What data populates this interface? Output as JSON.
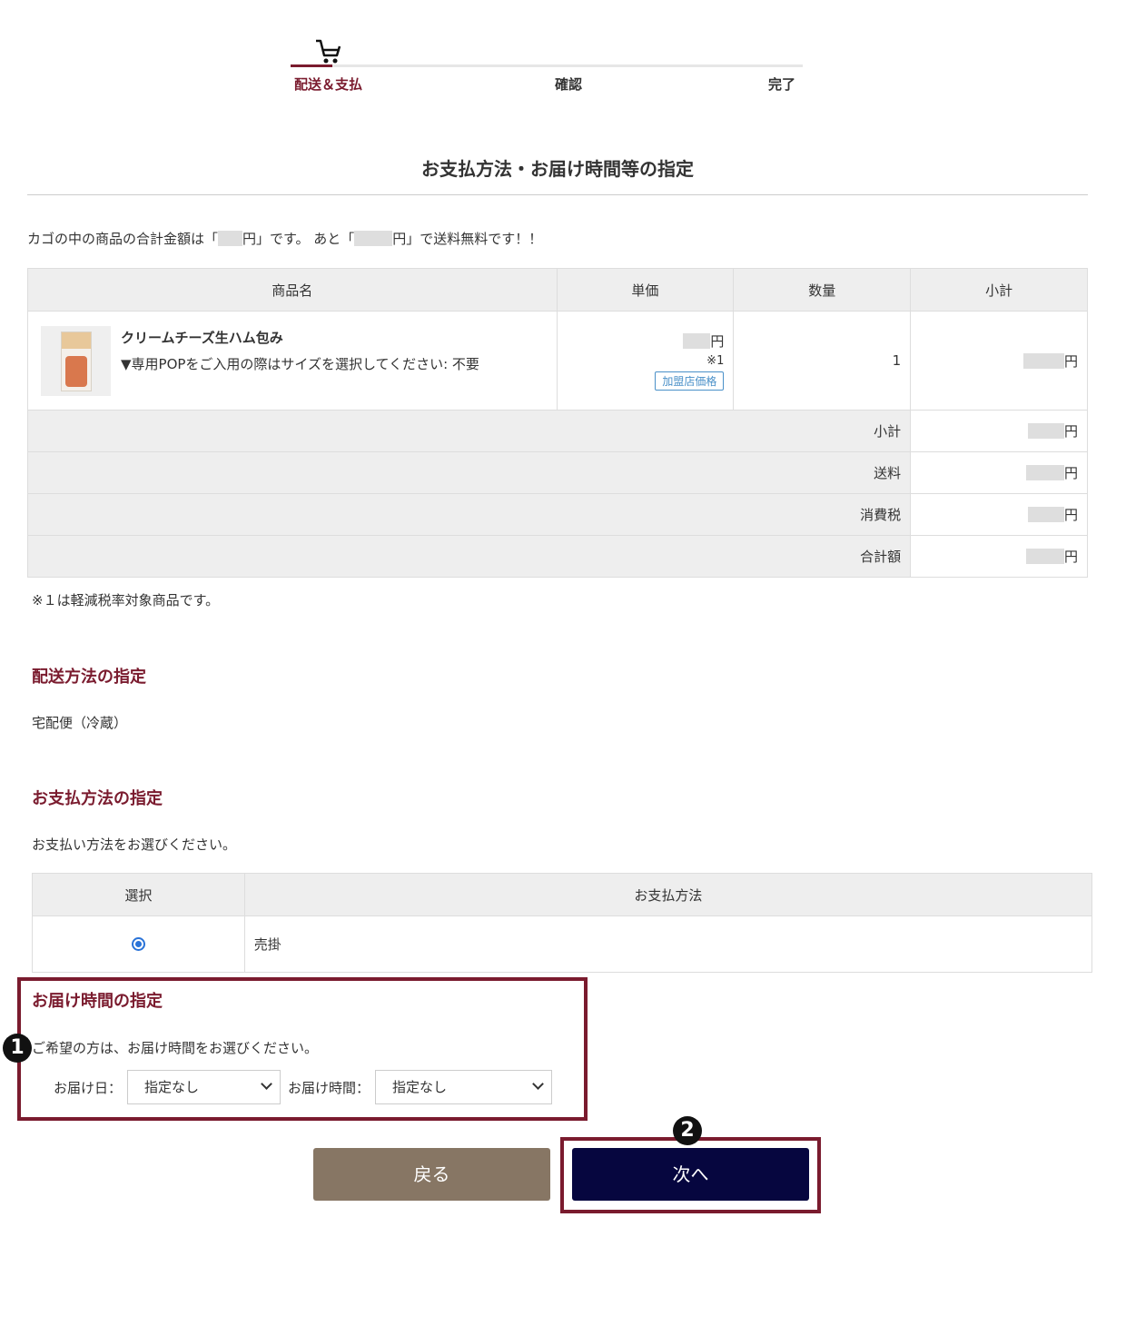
{
  "steps": {
    "items": [
      {
        "label": "配送＆支払",
        "active": true
      },
      {
        "label": "確認",
        "active": false
      },
      {
        "label": "完了",
        "active": false
      }
    ],
    "icon": "cart-icon"
  },
  "page_title": "お支払方法・お届け時間等の指定",
  "notice": {
    "prefix": "カゴの中の商品の合計金額は「",
    "middle": "円」です。 あと「",
    "suffix": "円」で送料無料です！！"
  },
  "cart_table": {
    "headers": [
      "商品名",
      "単価",
      "数量",
      "小計"
    ],
    "items": [
      {
        "name": "クリームチーズ生ハム包み",
        "option": "▼専用POPをご入用の際はサイズを選択してください: 不要",
        "unit_price_suffix": "円",
        "tax_note": "※1",
        "badge": "加盟店価格",
        "quantity": "1",
        "subtotal_suffix": "円"
      }
    ],
    "summary": [
      {
        "label": "小計",
        "suffix": "円"
      },
      {
        "label": "送料",
        "suffix": "円"
      },
      {
        "label": "消費税",
        "suffix": "円"
      },
      {
        "label": "合計額",
        "suffix": "円"
      }
    ]
  },
  "footnote": "※１は軽減税率対象商品です。",
  "shipping": {
    "heading": "配送方法の指定",
    "value": "宅配便（冷蔵）"
  },
  "payment": {
    "heading": "お支払方法の指定",
    "instruction": "お支払い方法をお選びください。",
    "headers": [
      "選択",
      "お支払方法"
    ],
    "options": [
      {
        "label": "売掛",
        "selected": true
      }
    ]
  },
  "delivery": {
    "heading": "お届け時間の指定",
    "instruction": "ご希望の方は、お届け時間をお選びください。",
    "date_label": "お届け日：",
    "date_value": "指定なし",
    "time_label": "お届け時間：",
    "time_value": "指定なし"
  },
  "buttons": {
    "back": "戻る",
    "next": "次へ"
  },
  "annotations": {
    "marker1": "1",
    "marker2": "2",
    "color": "#7a1b2e"
  }
}
